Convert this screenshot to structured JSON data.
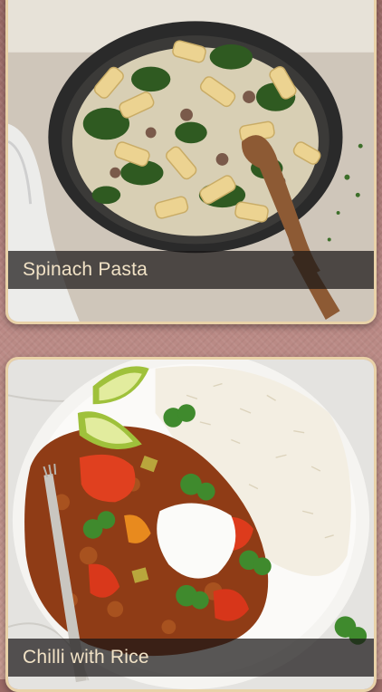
{
  "recipes": [
    {
      "title": "Spinach Pasta",
      "image": "spinach-pasta-photo"
    },
    {
      "title": "Chilli with Rice",
      "image": "chilli-with-rice-photo"
    }
  ],
  "colors": {
    "background": "#b98884",
    "card_border": "#e9d2a8",
    "caption_text": "#f1e2c6",
    "caption_bg": "#191616"
  }
}
